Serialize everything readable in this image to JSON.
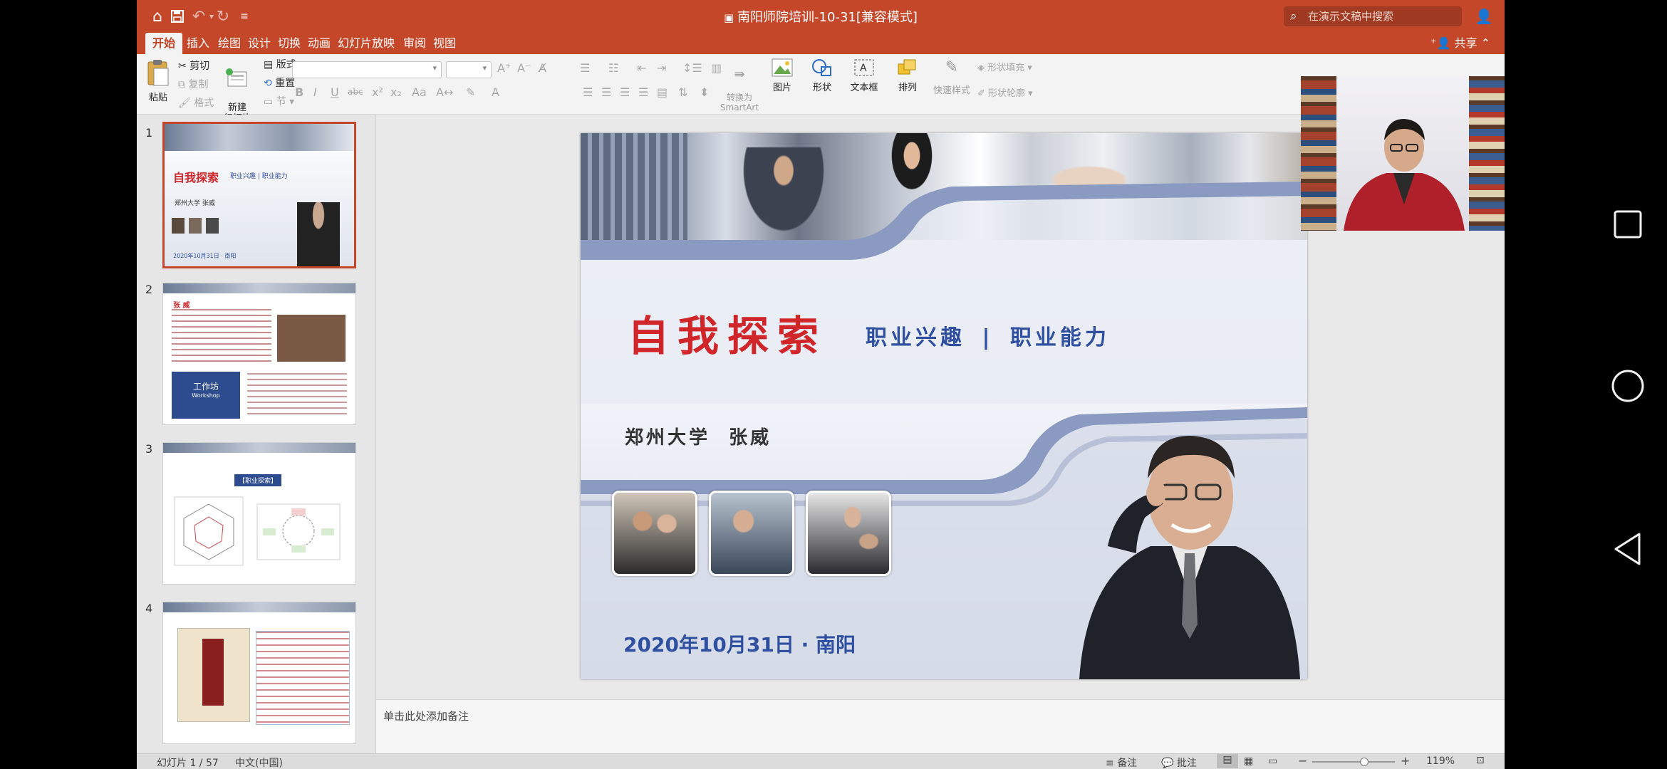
{
  "window": {
    "title": "南阳师院培训-10-31[兼容模式]",
    "search_placeholder": "在演示文稿中搜索"
  },
  "tabs": [
    "开始",
    "插入",
    "绘图",
    "设计",
    "切换",
    "动画",
    "幻灯片放映",
    "审阅",
    "视图"
  ],
  "share_label": "共享",
  "ribbon": {
    "paste": "粘贴",
    "cut": "剪切",
    "copy": "复制",
    "format_painter": "格式",
    "new_slide": "新建\n幻灯片",
    "layout": "版式",
    "reset": "重置",
    "section": "节",
    "convert_smartart": "转换为\nSmartArt",
    "picture": "图片",
    "shape": "形状",
    "textbox": "文本框",
    "arrange": "排列",
    "quick_styles": "快速样式",
    "shape_fill": "形状填充",
    "shape_outline": "形状轮廓"
  },
  "slide_numbers": [
    "1",
    "2",
    "3",
    "4"
  ],
  "thumbnails": {
    "t1_title": "自我探索",
    "t1_sub": "职业兴趣 | 职业能力",
    "t1_author": "郑州大学 张威",
    "t1_date": "2020年10月31日 · 南阳",
    "t2_heading": "张 威",
    "t2_box": "工作坊",
    "t2_box_sub": "Workshop",
    "t3_label": "【职业探索】"
  },
  "slide": {
    "title": "自我探索",
    "subtitle_left": "职业兴趣",
    "subtitle_sep": "|",
    "subtitle_right": "职业能力",
    "author": "郑州大学  张威",
    "date": "2020年10月31日 · 南阳"
  },
  "notes_placeholder": "单击此处添加备注",
  "status": {
    "slide_counter": "幻灯片 1 / 57",
    "language": "中文(中国)",
    "notes_btn": "备注",
    "comments_btn": "批注",
    "zoom": "119%"
  },
  "colors": {
    "accent": "#c4472a",
    "slide_title": "#d0262a",
    "slide_subtitle": "#2f4fa0"
  },
  "zoom_fraction": 0.62
}
